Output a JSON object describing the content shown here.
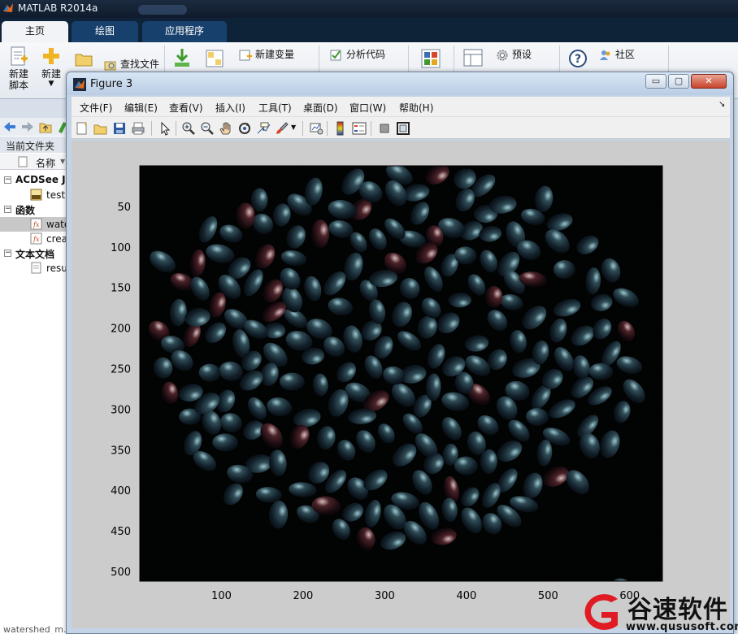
{
  "app": {
    "title": "MATLAB R2014a"
  },
  "ribbon": {
    "tabs": [
      "主页",
      "绘图",
      "应用程序"
    ],
    "new_script": "新建\n脚本",
    "new": "新建",
    "find_files": "查找文件",
    "new_variable": "新建变量",
    "analyze_code": "分析代码",
    "preferences": "预设",
    "community": "社区"
  },
  "left_panel": {
    "current_folder_label": "当前文件夹",
    "column_name": "名称",
    "tree": [
      {
        "type": "group",
        "label": "ACDSee JI"
      },
      {
        "type": "file",
        "label": "test.",
        "icon": "jpg-file-icon"
      },
      {
        "type": "group",
        "label": "函数"
      },
      {
        "type": "file",
        "label": "wate",
        "icon": "function-file-icon",
        "selected": true
      },
      {
        "type": "file",
        "label": "crea",
        "icon": "function-file-icon"
      },
      {
        "type": "group",
        "label": "文本文档"
      },
      {
        "type": "file",
        "label": "resu",
        "icon": "text-file-icon"
      }
    ],
    "status": "watershed_m..."
  },
  "figure": {
    "title": "Figure 3",
    "menus": [
      "文件(F)",
      "编辑(E)",
      "查看(V)",
      "插入(I)",
      "工具(T)",
      "桌面(D)",
      "窗口(W)",
      "帮助(H)"
    ],
    "window_buttons": {
      "minimize": "▭",
      "restore": "▢",
      "close": "✕"
    },
    "toolbar_icons": [
      "new-figure-icon",
      "open-file-icon",
      "save-icon",
      "print-icon",
      "pointer-icon",
      "zoom-in-icon",
      "zoom-out-icon",
      "pan-hand-icon",
      "rotate-3d-icon",
      "data-cursor-icon",
      "brush-icon",
      "link-plot-icon",
      "colorbar-icon",
      "legend-icon",
      "hide-plot-tools-icon",
      "show-plot-tools-icon"
    ],
    "plot": {
      "x_ticks": [
        "100",
        "200",
        "300",
        "400",
        "500",
        "600"
      ],
      "y_ticks": [
        "50",
        "100",
        "150",
        "200",
        "250",
        "300",
        "350",
        "400",
        "450",
        "500"
      ]
    }
  },
  "watermark": {
    "brand": "谷速软件",
    "url": "www.qususoft.com"
  }
}
